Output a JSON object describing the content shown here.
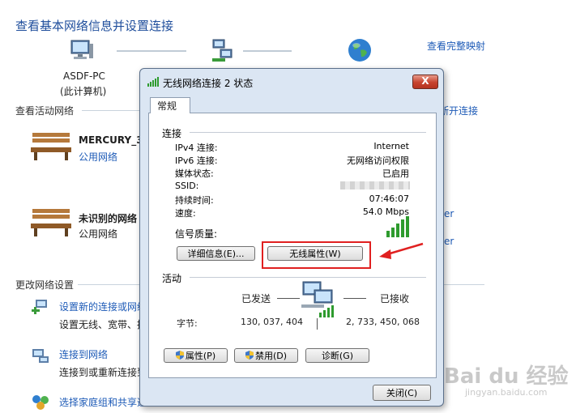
{
  "header": {
    "title": "查看基本网络信息并设置连接",
    "full_map_link": "查看完整映射",
    "pc_name": "ASDF-PC",
    "pc_caption": "(此计算机)"
  },
  "active": {
    "label": "查看活动网络",
    "disconnect_link": "或断开连接",
    "networks": [
      {
        "name": "MERCURY_3I",
        "type": "公用网络"
      },
      {
        "name": "未识别的网络",
        "type": "公用网络"
      }
    ],
    "right_links": [
      "er",
      "er"
    ]
  },
  "change": {
    "label": "更改网络设置",
    "items": [
      {
        "link": "设置新的连接或网络",
        "desc": "设置无线、宽带、拨"
      },
      {
        "link": "连接到网络",
        "desc": "连接到或重新连接到"
      },
      {
        "link": "选择家庭组和共享选",
        "desc": ""
      }
    ]
  },
  "dialog": {
    "title": "无线网络连接 2 状态",
    "close_glyph": "X",
    "tab": "常规",
    "connection": {
      "label": "连接",
      "rows": [
        {
          "label": "IPv4 连接:",
          "value": "Internet"
        },
        {
          "label": "IPv6 连接:",
          "value": "无网络访问权限"
        },
        {
          "label": "媒体状态:",
          "value": "已启用"
        },
        {
          "label": "SSID:",
          "value": ""
        },
        {
          "label": "持续时间:",
          "value": "07:46:07"
        },
        {
          "label": "速度:",
          "value": "54.0 Mbps"
        }
      ],
      "signal_label": "信号质量:",
      "details_button": "详细信息(E)...",
      "wireless_button": "无线属性(W)"
    },
    "activity": {
      "label": "活动",
      "sent_label": "已发送",
      "recv_label": "已接收",
      "bytes_label": "字节:",
      "sent_value": "130, 037, 404",
      "recv_value": "2, 733, 450, 068"
    },
    "buttons": {
      "properties": "属性(P)",
      "disable": "禁用(D)",
      "diagnose": "诊断(G)",
      "close": "关闭(C)"
    }
  },
  "watermark": {
    "brand": "Bai du 经验",
    "url": "jingyan.baidu.com"
  },
  "colors": {
    "link": "#1e5bb7",
    "highlight": "#e02020",
    "title": "#1f4e9c"
  }
}
